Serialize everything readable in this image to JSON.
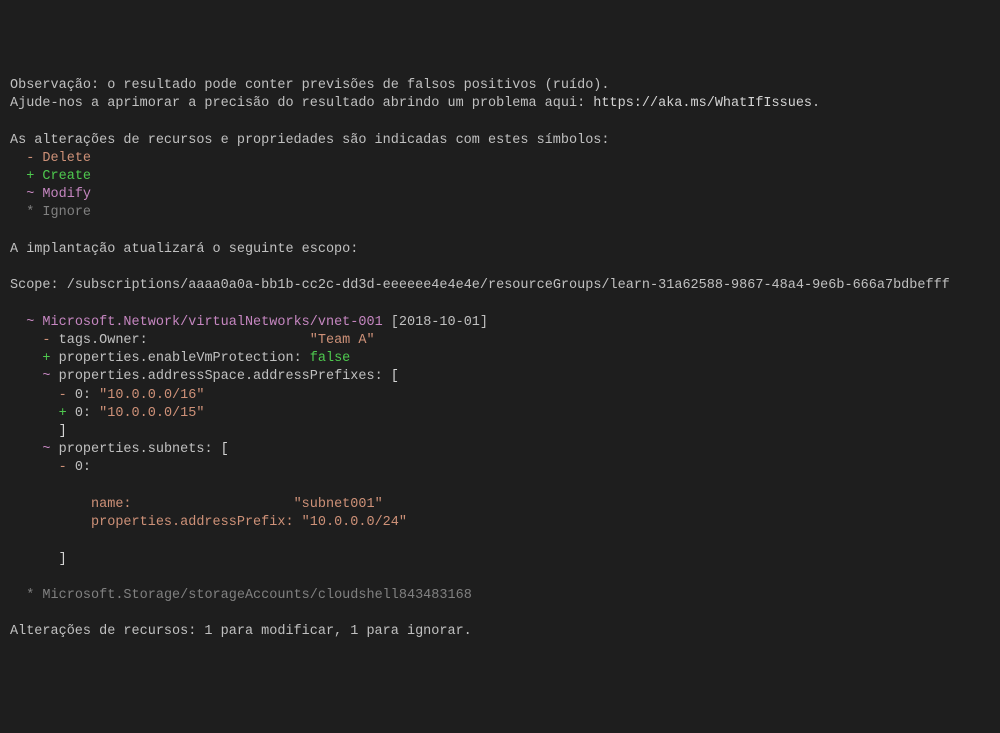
{
  "header": {
    "note_line1": "Observação: o resultado pode conter previsões de falsos positivos (ruído).",
    "note_line2_pre": "Ajude-nos a aprimorar a precisão do resultado abrindo um problema aqui: ",
    "note_line2_url": "https://aka.ms/WhatIfIssues",
    "note_line2_post": "."
  },
  "legend": {
    "intro": "As alterações de recursos e propriedades são indicadas com estes símbolos:",
    "items": [
      {
        "symbol": "-",
        "label": "Delete"
      },
      {
        "symbol": "+",
        "label": "Create"
      },
      {
        "symbol": "~",
        "label": "Modify"
      },
      {
        "symbol": "*",
        "label": "Ignore"
      }
    ]
  },
  "scope": {
    "intro": "A implantação atualizará o seguinte escopo:",
    "label": "Scope: ",
    "path_pre": "/subscriptions/",
    "subscription_id": "aaaa0a0a-bb1b-cc2c-dd3d-eeeeee4e4e4e",
    "path_mid": "/resourceGroups/",
    "resource_group": "learn-31a62588-9867-48a4-9e6b-666a7bdbefff"
  },
  "resources": {
    "modify": {
      "symbol": "~",
      "name": "Microsoft.Network/virtualNetworks/vnet-001",
      "api_version": "[2018-10-01]",
      "changes": [
        {
          "symbol": "-",
          "key": "tags.Owner:",
          "value": "\"Team A\"",
          "pad": 23
        },
        {
          "symbol": "+",
          "key": "properties.enableVmProtection:",
          "value": "false",
          "pad": 1
        },
        {
          "symbol": "~",
          "key": "properties.addressSpace.addressPrefixes:",
          "value": "["
        }
      ],
      "address_prefix_old": {
        "symbol": "-",
        "key": "0:",
        "value": "\"10.0.0.0/16\""
      },
      "address_prefix_new": {
        "symbol": "+",
        "key": "0:",
        "value": "\"10.0.0.0/15\""
      },
      "close_bracket": "]",
      "subnets_line": {
        "symbol": "~",
        "key": "properties.subnets:",
        "value": "["
      },
      "subnet_index": {
        "symbol": "-",
        "key": "0:"
      },
      "subnet_name": {
        "key": "name:",
        "value": "\"subnet001\"",
        "pad": 20
      },
      "subnet_prefix": {
        "key": "properties.addressPrefix:",
        "value": "\"10.0.0.0/24\"",
        "pad": 1
      },
      "close_bracket2": "]"
    },
    "ignore": {
      "symbol": "*",
      "name": "Microsoft.Storage/storageAccounts/cloudshell843483168"
    }
  },
  "footer": {
    "summary": "Alterações de recursos: 1 para modificar, 1 para ignorar."
  }
}
